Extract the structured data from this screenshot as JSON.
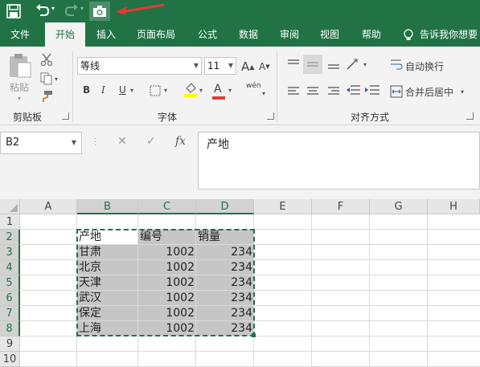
{
  "qat": {
    "save_icon": "save-icon",
    "undo_icon": "undo-icon",
    "redo_icon": "redo-icon",
    "camera_icon": "camera-icon",
    "annotation_color": "#e53935"
  },
  "tabs": [
    "文件",
    "开始",
    "插入",
    "页面布局",
    "公式",
    "数据",
    "审阅",
    "视图",
    "帮助"
  ],
  "tell_me": "告诉我你想要",
  "ribbon": {
    "clipboard": {
      "paste": "粘贴",
      "label": "剪贴板"
    },
    "font": {
      "name": "等线",
      "size": "11",
      "grow": "A",
      "shrink": "A",
      "bold": "B",
      "italic": "I",
      "underline": "U",
      "fill_letter": "A",
      "phonetic": "wén",
      "label": "字体"
    },
    "align": {
      "wrap": "自动换行",
      "merge": "合并后居中",
      "label": "对齐方式"
    }
  },
  "formula_bar": {
    "cell_ref": "B2",
    "cancel": "✕",
    "enter": "✓",
    "fx": "fx",
    "content": "产地"
  },
  "grid": {
    "columns": [
      "A",
      "B",
      "C",
      "D",
      "E",
      "F",
      "G",
      "H"
    ],
    "rows": [
      "1",
      "2",
      "3",
      "4",
      "5",
      "6",
      "7",
      "8",
      "9",
      "10"
    ],
    "headers": [
      "产地",
      "编号",
      "销量"
    ],
    "data": [
      [
        "甘肃",
        "1002",
        "234"
      ],
      [
        "北京",
        "1002",
        "234"
      ],
      [
        "天津",
        "1002",
        "234"
      ],
      [
        "武汉",
        "1002",
        "234"
      ],
      [
        "保定",
        "1002",
        "234"
      ],
      [
        "上海",
        "1002",
        "234"
      ]
    ]
  },
  "colors": {
    "accent": "#217346",
    "selection": "#c6c6c6"
  }
}
